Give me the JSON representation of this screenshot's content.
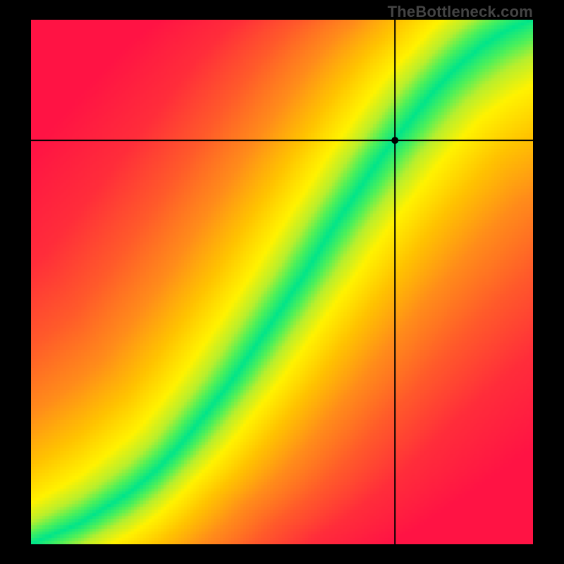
{
  "watermark": "TheBottleneck.com",
  "chart_data": {
    "type": "heatmap",
    "title": "",
    "xlabel": "",
    "ylabel": "",
    "xlim": [
      0,
      1
    ],
    "ylim": [
      0,
      1
    ],
    "optimal_curve": {
      "description": "Green optimal-balance band from bottom-left to top-right with slight S-curve; colors diverge to red away from it.",
      "x": [
        0.0,
        0.05,
        0.1,
        0.15,
        0.2,
        0.25,
        0.3,
        0.35,
        0.4,
        0.45,
        0.5,
        0.55,
        0.6,
        0.65,
        0.7,
        0.75,
        0.8,
        0.85,
        0.9,
        0.95,
        1.0
      ],
      "y": [
        0.0,
        0.02,
        0.04,
        0.07,
        0.1,
        0.14,
        0.19,
        0.25,
        0.31,
        0.38,
        0.45,
        0.52,
        0.6,
        0.67,
        0.74,
        0.8,
        0.86,
        0.91,
        0.95,
        0.98,
        1.0
      ]
    },
    "crosshair": {
      "x": 0.725,
      "y": 0.77
    },
    "color_stops": [
      {
        "d": 0.0,
        "color": "#00e58a"
      },
      {
        "d": 0.04,
        "color": "#4cf05a"
      },
      {
        "d": 0.08,
        "color": "#b8ef2d"
      },
      {
        "d": 0.14,
        "color": "#fff200"
      },
      {
        "d": 0.25,
        "color": "#ffc300"
      },
      {
        "d": 0.4,
        "color": "#ff8c1a"
      },
      {
        "d": 0.6,
        "color": "#ff5a2a"
      },
      {
        "d": 0.85,
        "color": "#ff2d3a"
      },
      {
        "d": 1.2,
        "color": "#ff1344"
      }
    ]
  }
}
